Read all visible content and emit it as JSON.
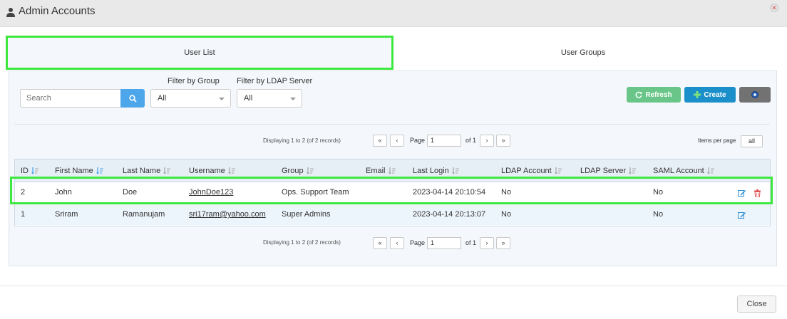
{
  "window": {
    "title": "Admin Accounts"
  },
  "tabs": [
    {
      "label": "User List",
      "active": true
    },
    {
      "label": "User Groups",
      "active": false
    }
  ],
  "filters": {
    "search_placeholder": "Search",
    "group_label": "Filter by Group",
    "group_value": "All",
    "ldap_label": "Filter by LDAP Server",
    "ldap_value": "All"
  },
  "toolbar": {
    "refresh_label": "Refresh",
    "create_label": "Create",
    "settings_icon": "gear-icon"
  },
  "pagination": {
    "display_text": "Displaying 1 to 2 (of 2 records)",
    "page_label": "Page",
    "page_value": "1",
    "of_text": "of 1",
    "first": "«",
    "prev": "‹",
    "next": "›",
    "last": "»",
    "items_per_page_label": "Items per page",
    "items_per_page_value": "all"
  },
  "table": {
    "columns": [
      "ID",
      "First Name",
      "Last Name",
      "Username",
      "Group",
      "Email",
      "Last Login",
      "LDAP Account",
      "LDAP Server",
      "SAML Account"
    ],
    "rows": [
      {
        "id": "2",
        "first_name": "John",
        "last_name": "Doe",
        "username": "JohnDoe123",
        "group": "Ops. Support Team",
        "email": "",
        "last_login": "2023-04-14 20:10:54",
        "ldap_account": "No",
        "ldap_server": "",
        "saml_account": "No",
        "deletable": true
      },
      {
        "id": "1",
        "first_name": "Sriram",
        "last_name": "Ramanujam",
        "username": "sri17ram@yahoo.com",
        "group": "Super Admins",
        "email": "",
        "last_login": "2023-04-14 20:13:07",
        "ldap_account": "No",
        "ldap_server": "",
        "saml_account": "No",
        "deletable": false
      }
    ]
  },
  "footer": {
    "close_label": "Close"
  },
  "colors": {
    "refresh": "#6ac688",
    "create": "#1a8fc9",
    "search_button": "#4da6ea",
    "highlight": "#3ee83e",
    "sort_icon": "#4da6ea"
  }
}
